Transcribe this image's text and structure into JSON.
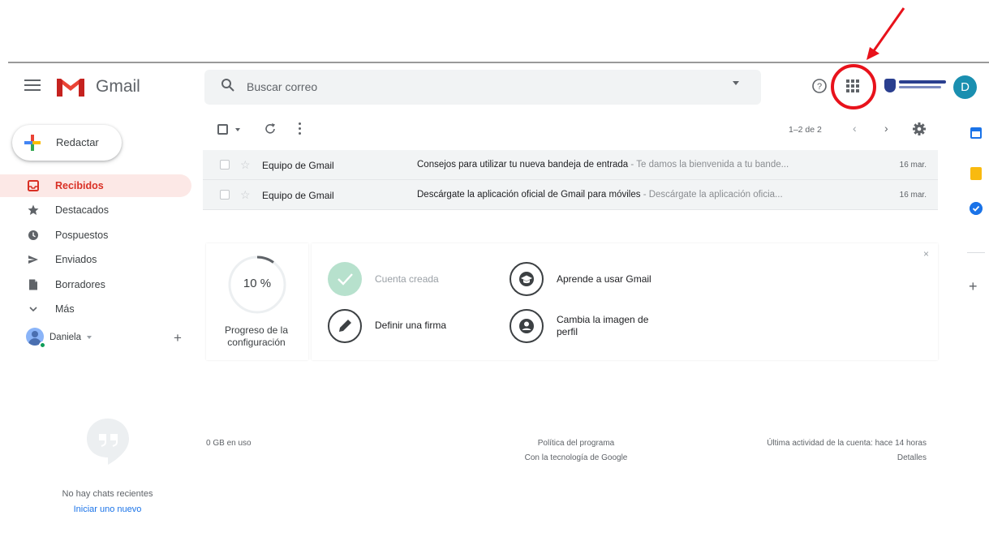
{
  "app": {
    "logo_text": "Gmail"
  },
  "search": {
    "placeholder": "Buscar correo"
  },
  "compose": {
    "label": "Redactar"
  },
  "sidebar": {
    "items": [
      {
        "label": "Recibidos",
        "icon": "inbox-icon",
        "active": true
      },
      {
        "label": "Destacados",
        "icon": "star-icon"
      },
      {
        "label": "Pospuestos",
        "icon": "clock-icon"
      },
      {
        "label": "Enviados",
        "icon": "send-icon"
      },
      {
        "label": "Borradores",
        "icon": "draft-icon"
      },
      {
        "label": "Más",
        "icon": "chevron-down-icon"
      }
    ],
    "user": {
      "name": "Daniela"
    },
    "chats": {
      "empty_text": "No hay chats recientes",
      "start_link": "Iniciar uno nuevo"
    }
  },
  "header": {
    "avatar_letter": "D"
  },
  "toolbar": {
    "range": "1–2 de 2"
  },
  "emails": [
    {
      "sender": "Equipo de Gmail",
      "subject": "Consejos para utilizar tu nueva bandeja de entrada",
      "snippet": " - Te damos la bienvenida a tu bande...",
      "date": "16 mar."
    },
    {
      "sender": "Equipo de Gmail",
      "subject": "Descárgate la aplicación oficial de Gmail para móviles",
      "snippet": " - Descárgate la aplicación oficia...",
      "date": "16 mar."
    }
  ],
  "setup": {
    "progress_text": "10 %",
    "progress_fraction": 0.1,
    "progress_label": "Progreso de la configuración",
    "tasks": [
      {
        "label": "Cuenta creada",
        "done": true
      },
      {
        "label": "Definir una firma"
      },
      {
        "label": "Aprende a usar Gmail"
      },
      {
        "label": "Cambia la imagen de perfil"
      }
    ]
  },
  "footer": {
    "usage": "0 GB en uso",
    "policy": "Política del programa",
    "powered": "Con la tecnología de Google",
    "activity": "Última actividad de la cuenta: hace 14 horas",
    "details": "Detalles"
  },
  "colors": {
    "annotation": "#e8121b",
    "accent_red": "#d93025",
    "avatar": "#1a8fb0"
  }
}
